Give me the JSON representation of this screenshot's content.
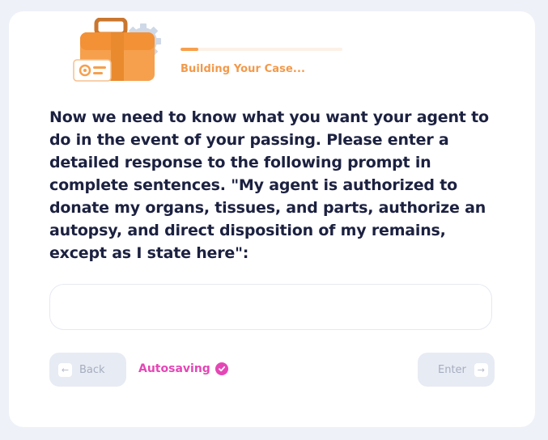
{
  "header": {
    "status_text": "Building Your Case...",
    "progress_fraction": 0.11
  },
  "prompt": {
    "text": "Now we need to know what you want your agent to do in the event of your passing. Please enter a detailed response to the following prompt in complete sentences. \"My agent is authorized to donate my organs, tissues, and parts, authorize an autopsy, and direct disposition of my remains, except as I state here\":"
  },
  "response": {
    "value": "",
    "placeholder": ""
  },
  "footer": {
    "back_label": "Back",
    "back_key_glyph": "←",
    "autosave_label": "Autosaving",
    "enter_label": "Enter",
    "enter_key_glyph": "→"
  },
  "colors": {
    "accent_orange": "#f6a04d",
    "autosave_pink": "#e447b5",
    "text_dark": "#1c2140"
  },
  "icons": {
    "illustration": "briefcase-gear-icon",
    "autosave": "check-circle-icon"
  }
}
